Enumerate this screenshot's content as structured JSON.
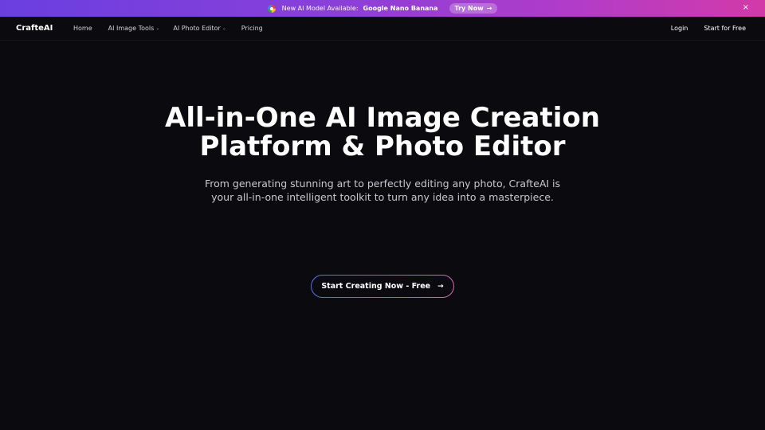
{
  "banner": {
    "prefix": "New AI Model Available:",
    "model": "Google Nano Banana",
    "try_label": "Try Now",
    "try_arrow": "→",
    "close": "×"
  },
  "nav": {
    "logo": "CrafteAI",
    "links": [
      {
        "label": "Home",
        "dropdown": false
      },
      {
        "label": "AI Image Tools",
        "dropdown": true
      },
      {
        "label": "AI Photo Editor",
        "dropdown": true
      },
      {
        "label": "Pricing",
        "dropdown": false
      }
    ],
    "login": "Login",
    "start": "Start for Free",
    "caret": "⌄"
  },
  "hero": {
    "title": "All-in-One AI Image Creation Platform & Photo Editor",
    "subtitle": "From generating stunning art to perfectly editing any photo, CrafteAI is your all-in-one intelligent toolkit to turn any idea into a masterpiece.",
    "cta_label": "Start Creating Now - Free",
    "cta_arrow": "→"
  },
  "colors": {
    "background": "#0b0b0f",
    "banner_start": "#6a3fe0",
    "banner_end": "#d23aa8"
  }
}
